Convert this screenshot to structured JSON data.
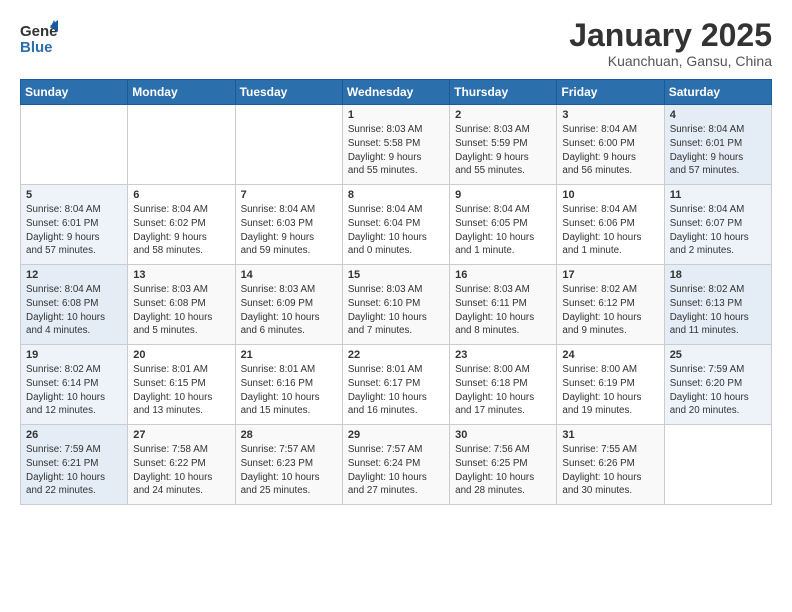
{
  "header": {
    "logo_general": "General",
    "logo_blue": "Blue",
    "month_title": "January 2025",
    "location": "Kuanchuan, Gansu, China"
  },
  "weekdays": [
    "Sunday",
    "Monday",
    "Tuesday",
    "Wednesday",
    "Thursday",
    "Friday",
    "Saturday"
  ],
  "weeks": [
    [
      {
        "day": "",
        "info": ""
      },
      {
        "day": "",
        "info": ""
      },
      {
        "day": "",
        "info": ""
      },
      {
        "day": "1",
        "info": "Sunrise: 8:03 AM\nSunset: 5:58 PM\nDaylight: 9 hours\nand 55 minutes."
      },
      {
        "day": "2",
        "info": "Sunrise: 8:03 AM\nSunset: 5:59 PM\nDaylight: 9 hours\nand 55 minutes."
      },
      {
        "day": "3",
        "info": "Sunrise: 8:04 AM\nSunset: 6:00 PM\nDaylight: 9 hours\nand 56 minutes."
      },
      {
        "day": "4",
        "info": "Sunrise: 8:04 AM\nSunset: 6:01 PM\nDaylight: 9 hours\nand 57 minutes."
      }
    ],
    [
      {
        "day": "5",
        "info": "Sunrise: 8:04 AM\nSunset: 6:01 PM\nDaylight: 9 hours\nand 57 minutes."
      },
      {
        "day": "6",
        "info": "Sunrise: 8:04 AM\nSunset: 6:02 PM\nDaylight: 9 hours\nand 58 minutes."
      },
      {
        "day": "7",
        "info": "Sunrise: 8:04 AM\nSunset: 6:03 PM\nDaylight: 9 hours\nand 59 minutes."
      },
      {
        "day": "8",
        "info": "Sunrise: 8:04 AM\nSunset: 6:04 PM\nDaylight: 10 hours\nand 0 minutes."
      },
      {
        "day": "9",
        "info": "Sunrise: 8:04 AM\nSunset: 6:05 PM\nDaylight: 10 hours\nand 1 minute."
      },
      {
        "day": "10",
        "info": "Sunrise: 8:04 AM\nSunset: 6:06 PM\nDaylight: 10 hours\nand 1 minute."
      },
      {
        "day": "11",
        "info": "Sunrise: 8:04 AM\nSunset: 6:07 PM\nDaylight: 10 hours\nand 2 minutes."
      }
    ],
    [
      {
        "day": "12",
        "info": "Sunrise: 8:04 AM\nSunset: 6:08 PM\nDaylight: 10 hours\nand 4 minutes."
      },
      {
        "day": "13",
        "info": "Sunrise: 8:03 AM\nSunset: 6:08 PM\nDaylight: 10 hours\nand 5 minutes."
      },
      {
        "day": "14",
        "info": "Sunrise: 8:03 AM\nSunset: 6:09 PM\nDaylight: 10 hours\nand 6 minutes."
      },
      {
        "day": "15",
        "info": "Sunrise: 8:03 AM\nSunset: 6:10 PM\nDaylight: 10 hours\nand 7 minutes."
      },
      {
        "day": "16",
        "info": "Sunrise: 8:03 AM\nSunset: 6:11 PM\nDaylight: 10 hours\nand 8 minutes."
      },
      {
        "day": "17",
        "info": "Sunrise: 8:02 AM\nSunset: 6:12 PM\nDaylight: 10 hours\nand 9 minutes."
      },
      {
        "day": "18",
        "info": "Sunrise: 8:02 AM\nSunset: 6:13 PM\nDaylight: 10 hours\nand 11 minutes."
      }
    ],
    [
      {
        "day": "19",
        "info": "Sunrise: 8:02 AM\nSunset: 6:14 PM\nDaylight: 10 hours\nand 12 minutes."
      },
      {
        "day": "20",
        "info": "Sunrise: 8:01 AM\nSunset: 6:15 PM\nDaylight: 10 hours\nand 13 minutes."
      },
      {
        "day": "21",
        "info": "Sunrise: 8:01 AM\nSunset: 6:16 PM\nDaylight: 10 hours\nand 15 minutes."
      },
      {
        "day": "22",
        "info": "Sunrise: 8:01 AM\nSunset: 6:17 PM\nDaylight: 10 hours\nand 16 minutes."
      },
      {
        "day": "23",
        "info": "Sunrise: 8:00 AM\nSunset: 6:18 PM\nDaylight: 10 hours\nand 17 minutes."
      },
      {
        "day": "24",
        "info": "Sunrise: 8:00 AM\nSunset: 6:19 PM\nDaylight: 10 hours\nand 19 minutes."
      },
      {
        "day": "25",
        "info": "Sunrise: 7:59 AM\nSunset: 6:20 PM\nDaylight: 10 hours\nand 20 minutes."
      }
    ],
    [
      {
        "day": "26",
        "info": "Sunrise: 7:59 AM\nSunset: 6:21 PM\nDaylight: 10 hours\nand 22 minutes."
      },
      {
        "day": "27",
        "info": "Sunrise: 7:58 AM\nSunset: 6:22 PM\nDaylight: 10 hours\nand 24 minutes."
      },
      {
        "day": "28",
        "info": "Sunrise: 7:57 AM\nSunset: 6:23 PM\nDaylight: 10 hours\nand 25 minutes."
      },
      {
        "day": "29",
        "info": "Sunrise: 7:57 AM\nSunset: 6:24 PM\nDaylight: 10 hours\nand 27 minutes."
      },
      {
        "day": "30",
        "info": "Sunrise: 7:56 AM\nSunset: 6:25 PM\nDaylight: 10 hours\nand 28 minutes."
      },
      {
        "day": "31",
        "info": "Sunrise: 7:55 AM\nSunset: 6:26 PM\nDaylight: 10 hours\nand 30 minutes."
      },
      {
        "day": "",
        "info": ""
      }
    ]
  ]
}
